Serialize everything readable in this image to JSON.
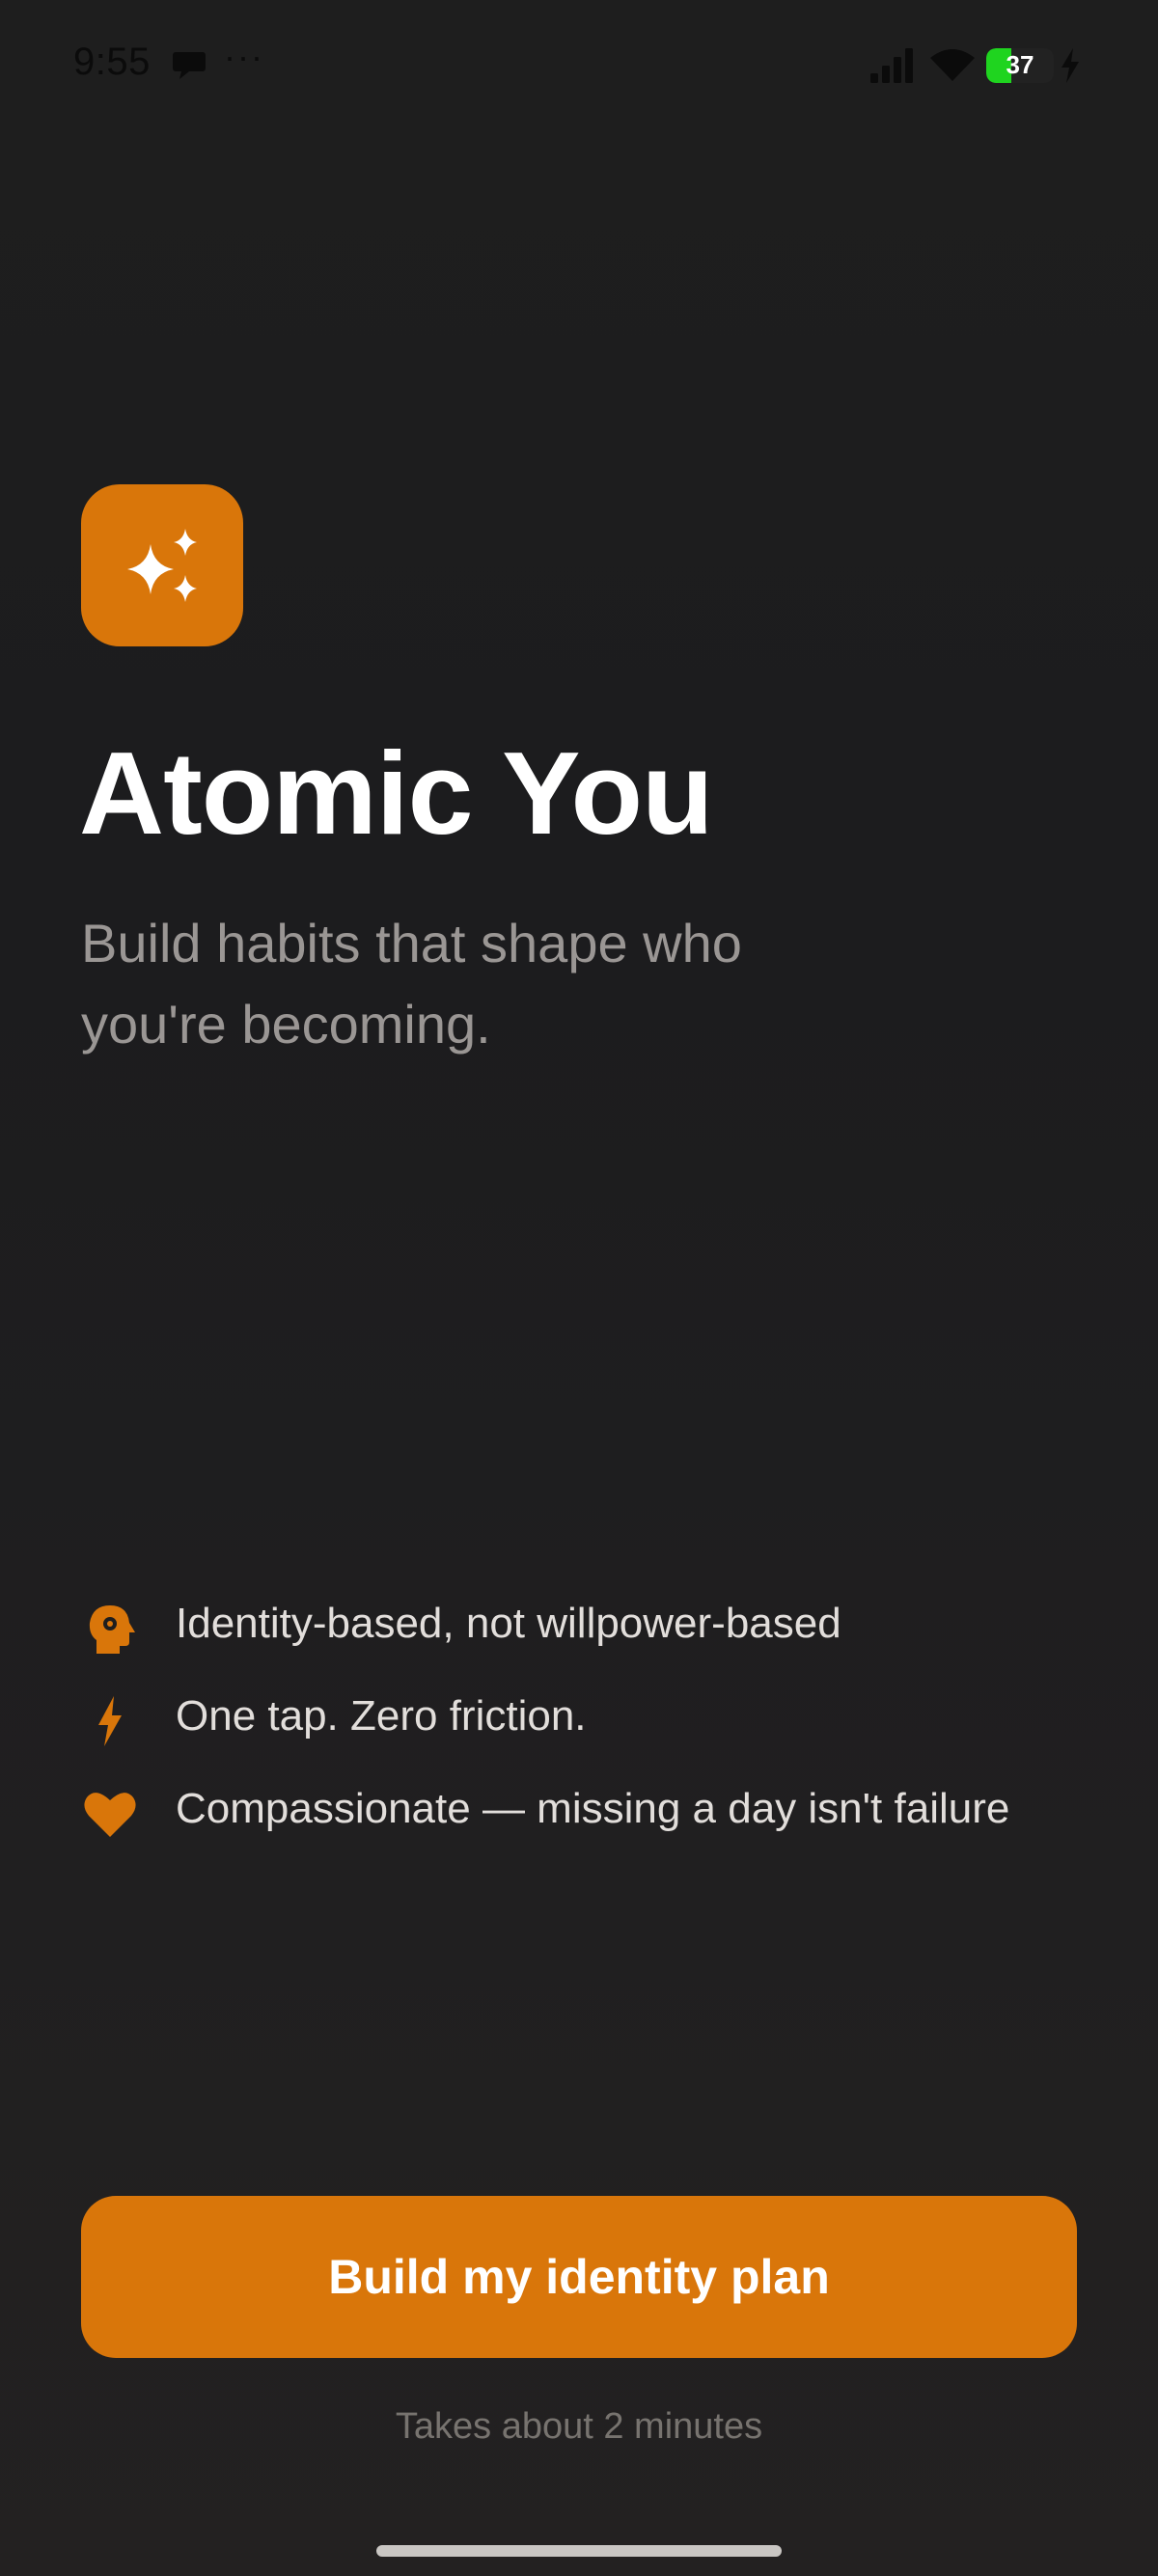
{
  "status_bar": {
    "time": "9:55",
    "more": "···",
    "battery": "37",
    "battery_level": 0.37
  },
  "app": {
    "title": "Atomic You",
    "subtitle": "Build habits that shape who you're becoming.",
    "icon": "sparkles-icon",
    "accent_color": "#d9760a"
  },
  "features": [
    {
      "icon": "head-gear-icon",
      "text": "Identity-based, not willpower-based"
    },
    {
      "icon": "bolt-icon",
      "text": "One tap. Zero friction."
    },
    {
      "icon": "heart-icon",
      "text": "Compassionate — missing a day isn't failure"
    }
  ],
  "cta": {
    "label": "Build my identity plan",
    "note": "Takes about 2 minutes"
  }
}
